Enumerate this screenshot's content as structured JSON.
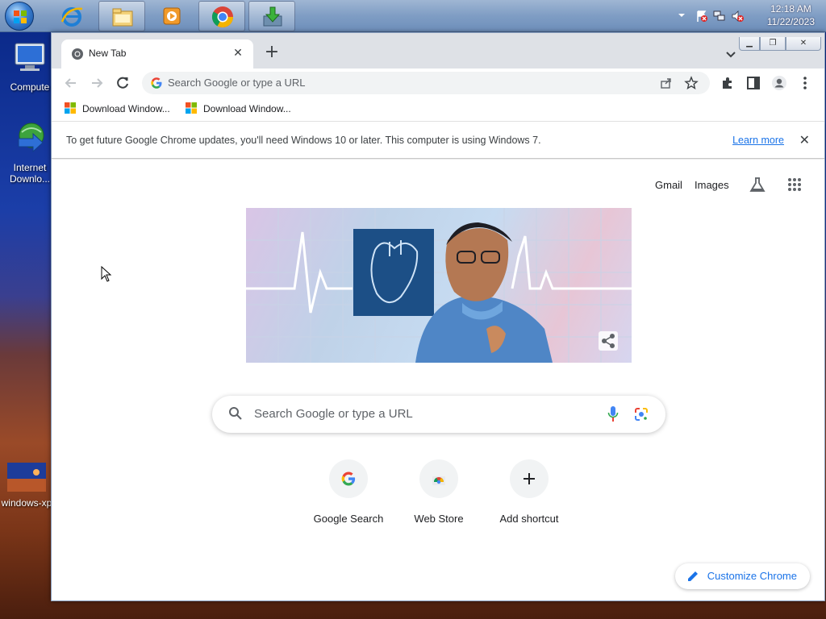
{
  "taskbar": {
    "clock_time": "12:18 AM",
    "clock_date": "11/22/2023"
  },
  "desktop": {
    "icons": [
      {
        "label": "Compute"
      },
      {
        "label": "Internet Downlo..."
      },
      {
        "label": "windows-xp"
      }
    ]
  },
  "browser": {
    "tab_title": "New Tab",
    "omnibox_placeholder": "Search Google or type a URL",
    "bookmarks": [
      {
        "label": "Download Window..."
      },
      {
        "label": "Download Window..."
      }
    ],
    "infobar": {
      "message": "To get future Google Chrome updates, you'll need Windows 10 or later. This computer is using Windows 7.",
      "link": "Learn more"
    }
  },
  "ntp": {
    "top_links": {
      "gmail": "Gmail",
      "images": "Images"
    },
    "search_placeholder": "Search Google or type a URL",
    "shortcuts": [
      {
        "label": "Google Search"
      },
      {
        "label": "Web Store"
      },
      {
        "label": "Add shortcut"
      }
    ],
    "customize_label": "Customize Chrome"
  },
  "colors": {
    "accent": "#1a73e8",
    "tabstrip": "#dee1e6",
    "omnibox": "#f1f3f4"
  }
}
